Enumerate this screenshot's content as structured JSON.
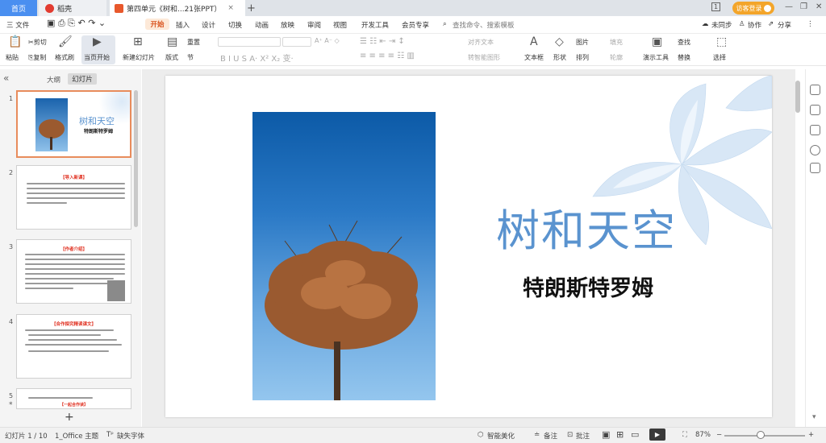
{
  "titlebar": {
    "home_tab": "首页",
    "daoke_tab": "稻壳",
    "doc_tab": "第四单元《树和...21张PPT）",
    "add_tab": "+",
    "page_indicator": "1",
    "visitor_button": "访客登录"
  },
  "menubar": {
    "file": "三 文件",
    "items": [
      "开始",
      "插入",
      "设计",
      "切换",
      "动画",
      "放映",
      "审阅",
      "视图",
      "开发工具",
      "会员专享"
    ],
    "search_placeholder": "查找命令、搜索模板",
    "sync": "未同步",
    "collab": "协作",
    "share": "分享"
  },
  "ribbon": {
    "paste": "粘贴",
    "cut": "剪切",
    "copy": "复制",
    "format_painter": "格式刷",
    "current_start": "当页开始",
    "new_slide": "新建幻灯片",
    "layout": "版式",
    "section": "节",
    "reset": "重置",
    "text_direction": "对齐文本",
    "smart_graphic": "转智能图形",
    "textbox": "文本框",
    "shape": "形状",
    "picture": "图片",
    "fill": "填充",
    "arrange": "排列",
    "outline": "轮廓",
    "presenter": "演示工具",
    "find": "查找",
    "replace": "替换",
    "select": "选择"
  },
  "leftpanel": {
    "outline_tab": "大纲",
    "slides_tab": "幻灯片",
    "thumbs": [
      {
        "num": "1",
        "title": "树和天空",
        "subtitle": "特朗斯特罗姆"
      },
      {
        "num": "2",
        "title": "【导入新课】"
      },
      {
        "num": "3",
        "title": "【作者介绍】"
      },
      {
        "num": "4",
        "title": "【合作探究精读课文】"
      },
      {
        "num": "5",
        "title": "【一起合作读】"
      }
    ],
    "add_slide": "+"
  },
  "slide": {
    "title": "树和天空",
    "author": "特朗斯特罗姆"
  },
  "statusbar": {
    "slide_count": "幻灯片 1 / 10",
    "theme": "1_Office 主题",
    "missing_font": "缺失字体",
    "smart_beautify": "智能美化",
    "notes": "备注",
    "comments": "批注",
    "zoom": "87%"
  }
}
